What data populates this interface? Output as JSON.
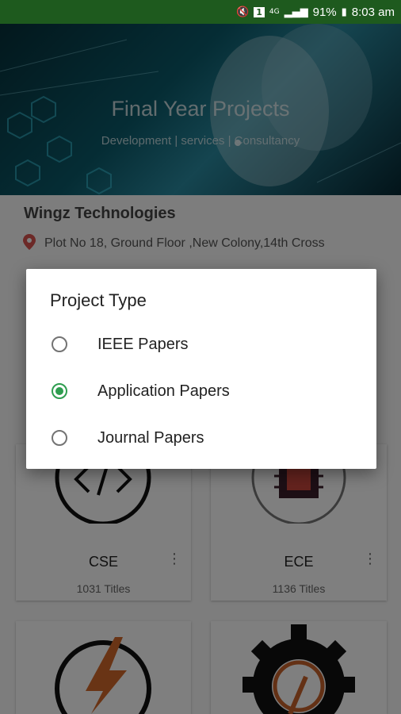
{
  "status": {
    "battery": "91%",
    "time": "8:03 am",
    "sim": "1",
    "network": "4G"
  },
  "hero": {
    "title": "Final Year Projects",
    "subtitle": "Development | services | Consultancy"
  },
  "company": {
    "name": "Wingz Technologies",
    "address": "Plot No 18, Ground Floor ,New Colony,14th Cross"
  },
  "cards": [
    {
      "name": "CSE",
      "count": "1031 Titles",
      "icon": "code-icon"
    },
    {
      "name": "ECE",
      "count": "1136 Titles",
      "icon": "chip-icon"
    },
    {
      "name": "",
      "count": "",
      "icon": "lightning-icon"
    },
    {
      "name": "",
      "count": "",
      "icon": "gear-icon"
    }
  ],
  "dialog": {
    "title": "Project Type",
    "options": [
      {
        "label": "IEEE Papers",
        "selected": false
      },
      {
        "label": "Application Papers",
        "selected": true
      },
      {
        "label": "Journal Papers",
        "selected": false
      }
    ]
  },
  "colors": {
    "statusbar": "#1e5a1e",
    "accent": "#2e9d4f"
  }
}
